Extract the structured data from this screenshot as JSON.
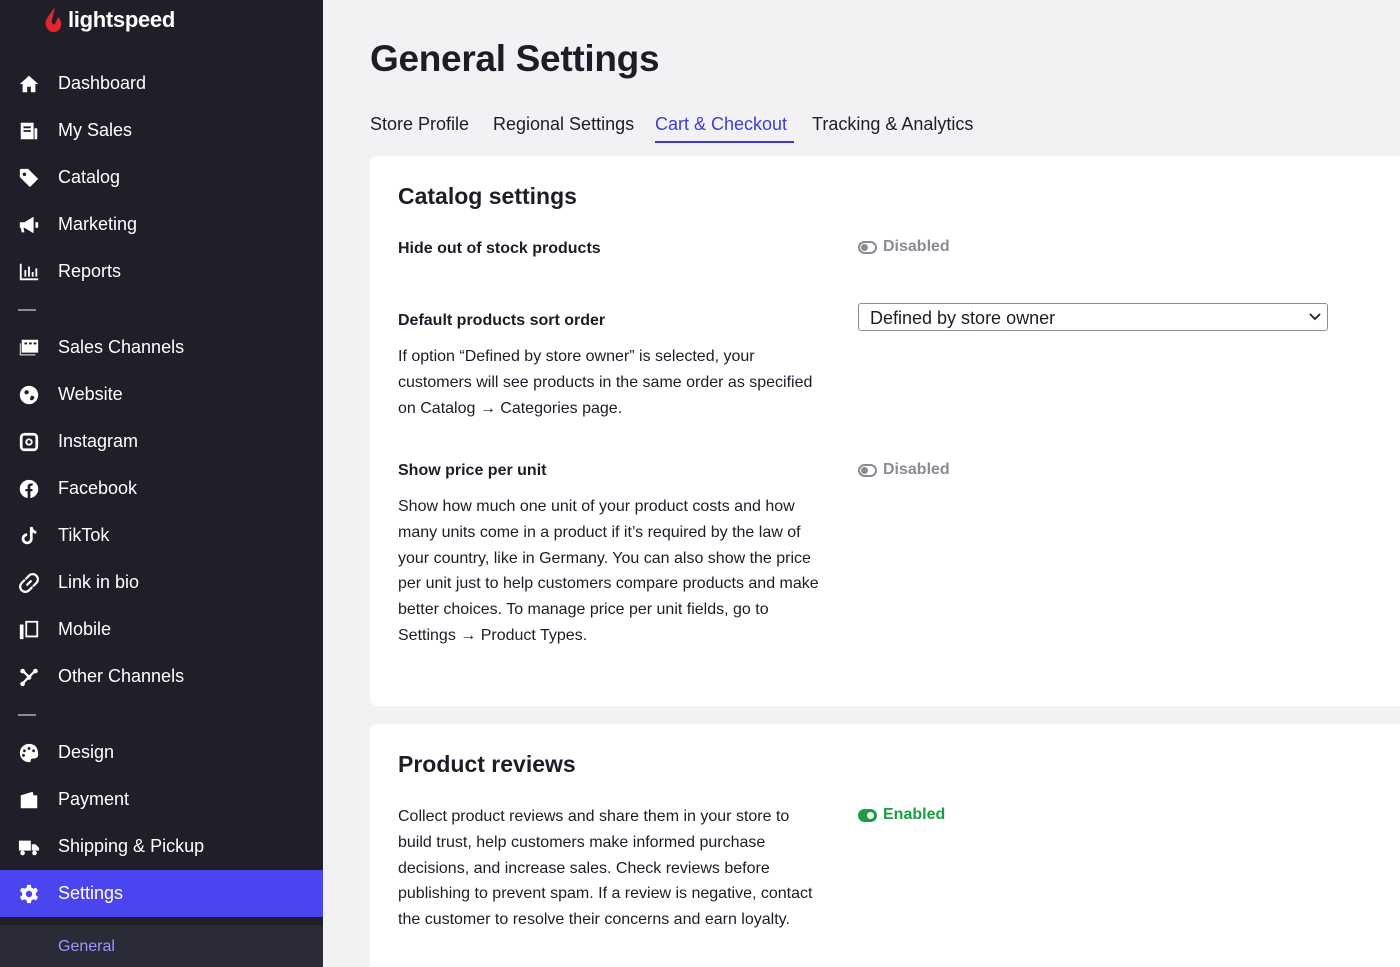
{
  "brand": {
    "name": "lightspeed",
    "accent": "#4b45f0",
    "logo_color": "#e4252b"
  },
  "sidebar": {
    "items": [
      {
        "label": "Dashboard",
        "icon": "home-icon"
      },
      {
        "label": "My Sales",
        "icon": "receipt-icon"
      },
      {
        "label": "Catalog",
        "icon": "tag-icon"
      },
      {
        "label": "Marketing",
        "icon": "megaphone-icon"
      },
      {
        "label": "Reports",
        "icon": "bar-chart-icon"
      },
      {
        "label": "Sales Channels",
        "icon": "storefront-icon"
      },
      {
        "label": "Website",
        "icon": "globe-icon"
      },
      {
        "label": "Instagram",
        "icon": "instagram-icon"
      },
      {
        "label": "Facebook",
        "icon": "facebook-icon"
      },
      {
        "label": "TikTok",
        "icon": "tiktok-icon"
      },
      {
        "label": "Link in bio",
        "icon": "link-icon"
      },
      {
        "label": "Mobile",
        "icon": "mobile-icon"
      },
      {
        "label": "Other Channels",
        "icon": "share-icon"
      },
      {
        "label": "Design",
        "icon": "palette-icon"
      },
      {
        "label": "Payment",
        "icon": "wallet-icon"
      },
      {
        "label": "Shipping & Pickup",
        "icon": "truck-icon"
      },
      {
        "label": "Settings",
        "icon": "gear-icon",
        "active": true
      }
    ],
    "sub_item": "General"
  },
  "main": {
    "title": "General Settings",
    "tabs": [
      {
        "label": "Store Profile"
      },
      {
        "label": "Regional Settings"
      },
      {
        "label": "Cart & Checkout",
        "active": true
      },
      {
        "label": "Tracking & Analytics"
      }
    ]
  },
  "catalog_card": {
    "title": "Catalog settings",
    "hide_out_of_stock": {
      "label": "Hide out of stock products",
      "status": "Disabled"
    },
    "sort_order": {
      "label": "Default products sort order",
      "desc_lines": [
        "If option “Defined by store owner” is selected, your",
        "customers will see products in the same order as specified",
        "on Catalog → Categories page."
      ],
      "selected": "Defined by store owner"
    },
    "price_per_unit": {
      "label": "Show price per unit",
      "status": "Disabled",
      "desc_lines": [
        "Show how much one unit of your product costs and how",
        "many units come in a product if it’s required by the law of",
        "your country, like in Germany. You can also show the price",
        "per unit just to help customers compare products and make",
        "better choices. To manage price per unit fields, go to",
        "Settings → Product Types."
      ]
    }
  },
  "reviews_card": {
    "title": "Product reviews",
    "status": "Enabled",
    "desc_lines": [
      "Collect product reviews and share them in your store to",
      "build trust, help customers make informed purchase",
      "decisions, and increase sales. Check reviews before",
      "publishing to prevent spam. If a review is negative, contact",
      "the customer to resolve their concerns and earn loyalty."
    ]
  }
}
